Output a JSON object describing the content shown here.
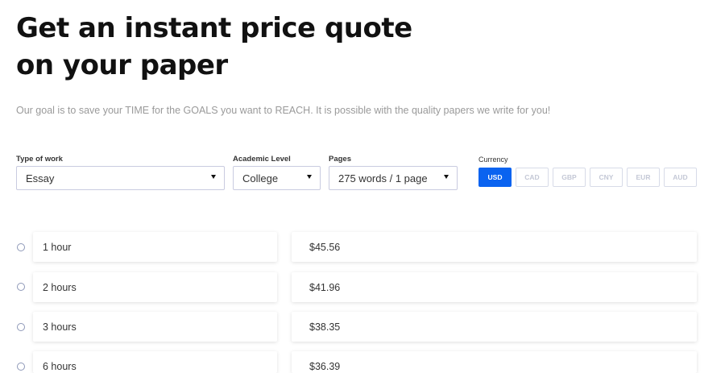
{
  "header": {
    "title": "Get an instant price quote on your paper",
    "subtitle": "Our goal is to save your TIME for the GOALS you want to REACH. It is possible with the quality papers we write for you!"
  },
  "form": {
    "type_of_work": {
      "label": "Type of work",
      "value": "Essay"
    },
    "academic_level": {
      "label": "Academic Level",
      "value": "College"
    },
    "pages": {
      "label": "Pages",
      "value": "275 words / 1 page"
    },
    "currency": {
      "label": "Currency",
      "selected": "USD",
      "options": [
        "USD",
        "CAD",
        "GBP",
        "CNY",
        "EUR",
        "AUD"
      ]
    }
  },
  "deadlines": [
    {
      "deadline": "1 hour",
      "price": "$45.56"
    },
    {
      "deadline": "2 hours",
      "price": "$41.96"
    },
    {
      "deadline": "3 hours",
      "price": "$38.35"
    },
    {
      "deadline": "6 hours",
      "price": "$36.39"
    }
  ],
  "colors": {
    "accent": "#0a63f0",
    "muted_text": "#9a9a9a",
    "border": "#c9cbe0"
  },
  "icons": {
    "select_caret": "caret-down-icon",
    "row_selector": "radio-icon"
  }
}
